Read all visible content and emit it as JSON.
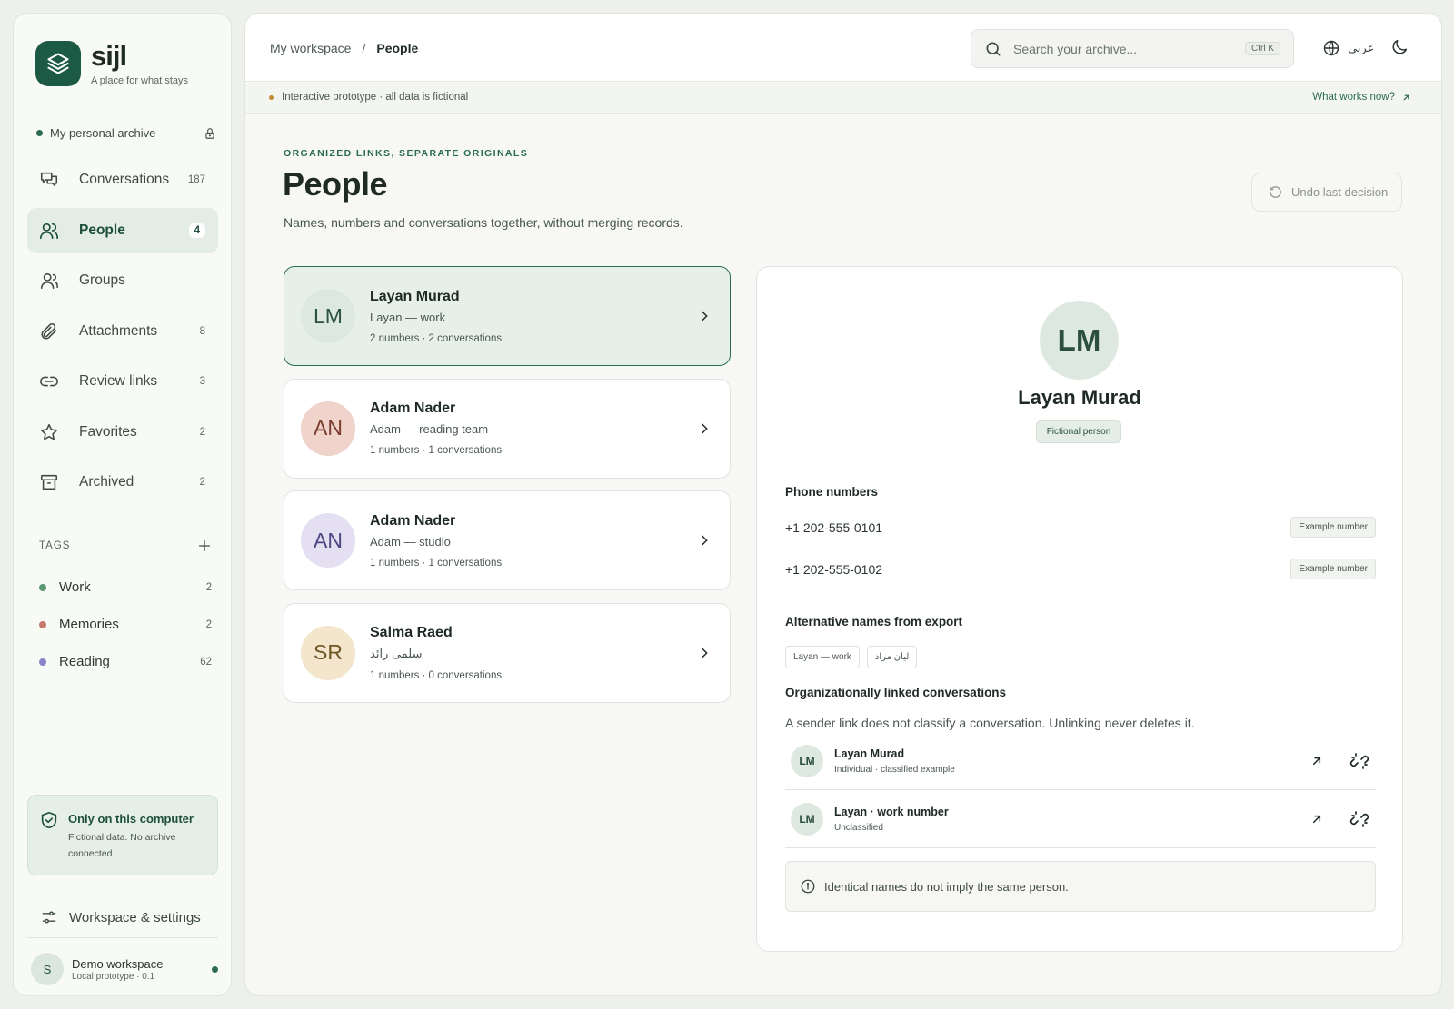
{
  "brand": {
    "name": "sijl",
    "tagline": "A place for what stays",
    "accent": "#1c5a45"
  },
  "sidebar": {
    "archive_label": "My personal archive",
    "nav": [
      {
        "label": "Conversations",
        "count": "187",
        "icon": "chat-icon"
      },
      {
        "label": "People",
        "count": "4",
        "icon": "people-icon",
        "active": true
      },
      {
        "label": "Groups",
        "count": "",
        "icon": "group-icon"
      },
      {
        "label": "Attachments",
        "count": "8",
        "icon": "paperclip-icon"
      },
      {
        "label": "Review links",
        "count": "3",
        "icon": "link-icon"
      },
      {
        "label": "Favorites",
        "count": "2",
        "icon": "star-icon"
      },
      {
        "label": "Archived",
        "count": "2",
        "icon": "archive-icon"
      }
    ],
    "tags_heading": "TAGS",
    "tags": [
      {
        "label": "Work",
        "count": "2",
        "color": "#5d9a73"
      },
      {
        "label": "Memories",
        "count": "2",
        "color": "#c4786a"
      },
      {
        "label": "Reading",
        "count": "62",
        "color": "#8a83c7"
      }
    ],
    "privacy": {
      "title": "Only on this computer",
      "text": "Fictional data. No archive connected."
    },
    "settings_label": "Workspace & settings",
    "user": {
      "initial": "S",
      "name": "Demo workspace",
      "sub": "Local prototype · 0.1"
    }
  },
  "topbar": {
    "breadcrumb_root": "My workspace",
    "breadcrumb_sep": "/",
    "breadcrumb_current": "People",
    "search_placeholder": "Search your archive...",
    "search_shortcut": "Ctrl K",
    "language_label": "عربي"
  },
  "banner": {
    "text": "Interactive prototype · all data is fictional",
    "link": "What works now?"
  },
  "page": {
    "eyebrow": "ORGANIZED LINKS, SEPARATE ORIGINALS",
    "title": "People",
    "subtitle": "Names, numbers and conversations together, without merging records.",
    "undo_label": "Undo last decision"
  },
  "people": [
    {
      "initials": "LM",
      "name": "Layan Murad",
      "alias": "Layan — work",
      "meta": "2 numbers · 2 conversations",
      "avatar_bg": "#dde9e0",
      "avatar_fg": "#2d5242",
      "active": true
    },
    {
      "initials": "AN",
      "name": "Adam Nader",
      "alias": "Adam — reading team",
      "meta": "1 numbers · 1 conversations",
      "avatar_bg": "#f0d4cc",
      "avatar_fg": "#7a3b2c"
    },
    {
      "initials": "AN",
      "name": "Adam Nader",
      "alias": "Adam — studio",
      "meta": "1 numbers · 1 conversations",
      "avatar_bg": "#e4e0f2",
      "avatar_fg": "#4e4785"
    },
    {
      "initials": "SR",
      "name": "Salma Raed",
      "alias": "سلمى رائد",
      "meta": "1 numbers · 0 conversations",
      "avatar_bg": "#f3e6cc",
      "avatar_fg": "#6e5626"
    }
  ],
  "detail": {
    "initials": "LM",
    "name": "Layan Murad",
    "badge": "Fictional person",
    "phones_title": "Phone numbers",
    "phones": [
      {
        "number": "+1 202-555-0101",
        "badge": "Example number"
      },
      {
        "number": "+1 202-555-0102",
        "badge": "Example number"
      }
    ],
    "alt_title": "Alternative names from export",
    "alt_names": [
      "Layan — work",
      "ليان مراد"
    ],
    "org_title": "Organizationally linked conversations",
    "org_sub": "A sender link does not classify a conversation. Unlinking never deletes it.",
    "conversations": [
      {
        "initials": "LM",
        "name": "Layan Murad",
        "sub": "Individual · classified example"
      },
      {
        "initials": "LM",
        "name": "Layan · work number",
        "sub": "Unclassified"
      }
    ],
    "note": "Identical names do not imply the same person."
  }
}
